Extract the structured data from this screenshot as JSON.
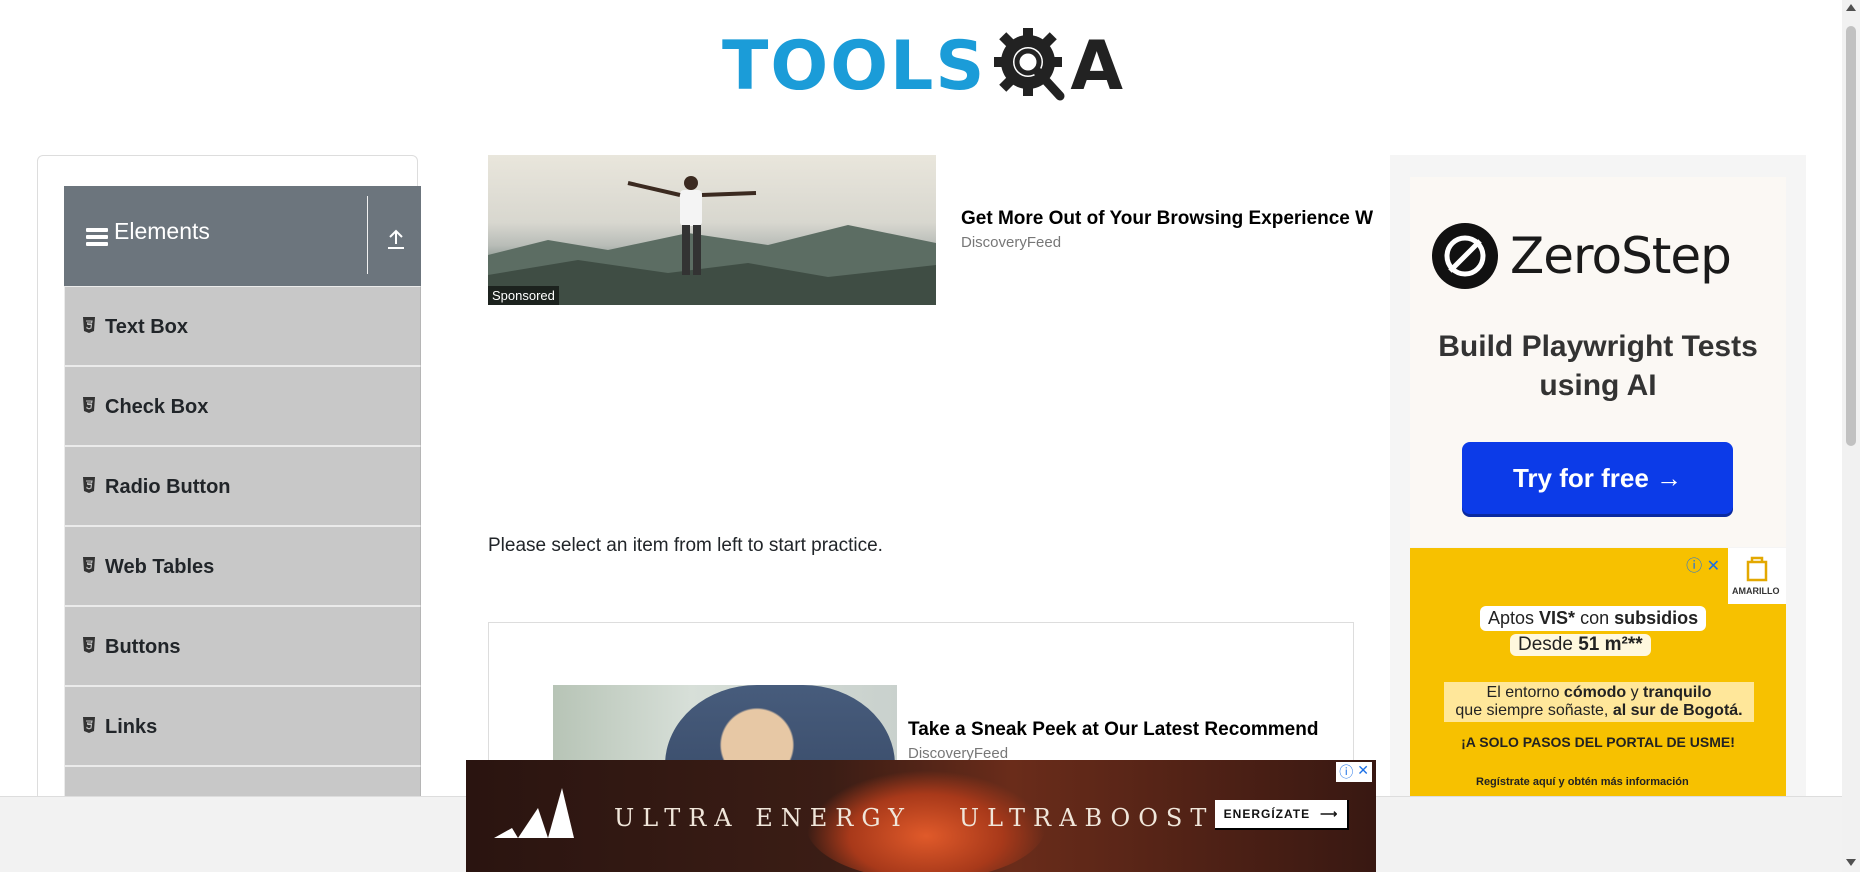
{
  "header": {
    "logo_main": "TOOLS",
    "logo_tail": "A"
  },
  "sidebar": {
    "group_title": "Elements",
    "items": [
      {
        "label": "Text Box"
      },
      {
        "label": "Check Box"
      },
      {
        "label": "Radio Button"
      },
      {
        "label": "Web Tables"
      },
      {
        "label": "Buttons"
      },
      {
        "label": "Links"
      },
      {
        "label": ""
      }
    ]
  },
  "main": {
    "instruction": "Please select an item from left to start practice.",
    "ad1": {
      "badge": "Sponsored",
      "title": "Get More Out of Your Browsing Experience W",
      "source": "DiscoveryFeed"
    },
    "ad2": {
      "title": "Take a Sneak Peek at Our Latest Recommendations",
      "source": "DiscoveryFeed"
    }
  },
  "right_ad": {
    "brand": "ZeroStep",
    "tagline": "Build Playwright Tests using AI",
    "cta": "Try for free →",
    "amarillo": {
      "logo_text": "AMARILLO",
      "line1_pre": "Aptos ",
      "line1_b1": "VIS*",
      "line1_mid": " con ",
      "line1_b2": "subsidios",
      "line2_pre": "Desde ",
      "line2_b": "51 m²**",
      "line3_a": "El entorno ",
      "line3_b": "cómodo",
      "line3_c": " y ",
      "line3_d": "tranquilo",
      "line3_e": "que siempre soñaste, ",
      "line3_f": "al sur de Bogotá.",
      "line4": "¡A SOLO PASOS DEL PORTAL DE USME!",
      "line5": "Regístrate aquí y obtén más información"
    }
  },
  "banner": {
    "headline": "ULTRA ENERGY   ULTRABOOST",
    "cta": "ENERGÍZATE"
  },
  "colors": {
    "logo_blue": "#1b9cd8",
    "sidebar_header": "#6c757d",
    "menu_item_bg": "#c8c8c8",
    "zerostep_button": "#0c3be8",
    "amarillo_yellow": "#f7c100"
  }
}
